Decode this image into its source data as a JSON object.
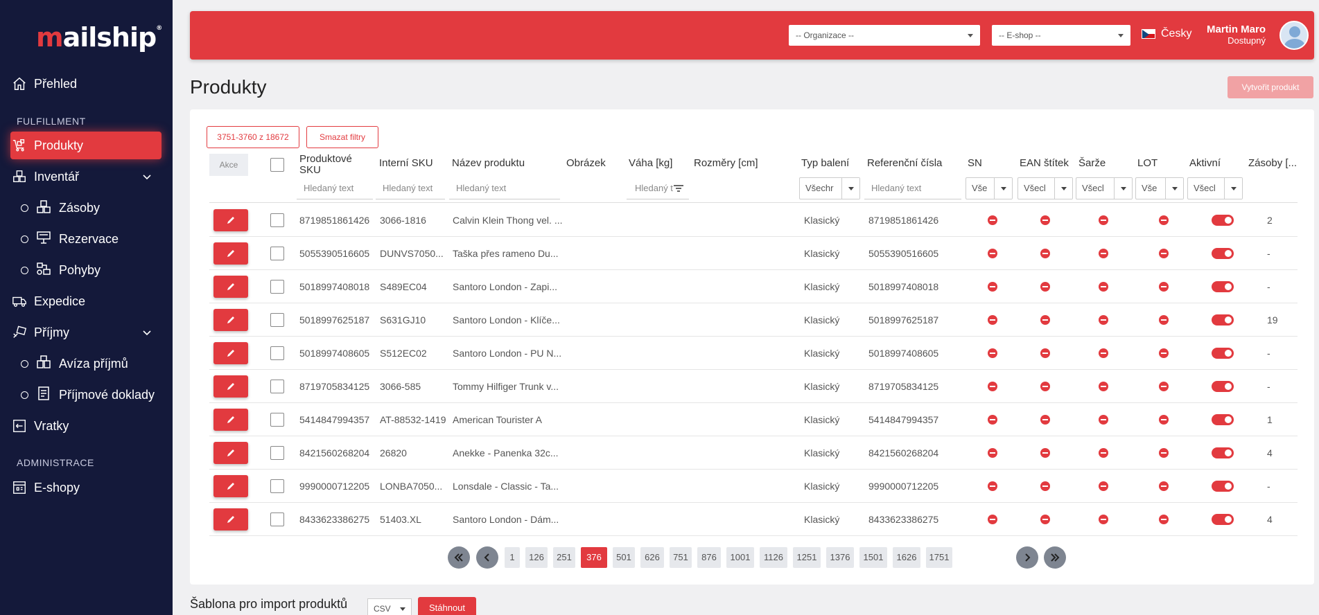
{
  "app": {
    "logo": "mailship",
    "logo_mark": "®"
  },
  "sidebar": {
    "overview": "Přehled",
    "section_fulfillment": "FULFILLMENT",
    "products": "Produkty",
    "inventory": "Inventář",
    "stock": "Zásoby",
    "reservations": "Rezervace",
    "movements": "Pohyby",
    "expedition": "Expedice",
    "receipts": "Příjmy",
    "receipt_notices": "Avíza příjmů",
    "receipt_docs": "Příjmové doklady",
    "returns": "Vratky",
    "section_admin": "ADMINISTRACE",
    "eshops": "E-shopy"
  },
  "header": {
    "org_select": "-- Organizace --",
    "eshop_select": "-- E-shop --",
    "language": "Česky",
    "user_name": "Martin Maro",
    "user_status": "Dostupný"
  },
  "page": {
    "title": "Produkty",
    "create_button": "Vytvořit produkt"
  },
  "toolbar": {
    "range_chip": "3751-3760 z 18672",
    "clear_filters": "Smazat filtry"
  },
  "table": {
    "columns": {
      "akce": "Akce",
      "sku_line1": "Produktové",
      "sku_line2": "SKU",
      "internal_sku": "Interní SKU",
      "name": "Název produktu",
      "image": "Obrázek",
      "weight": "Váha [kg]",
      "dimensions": "Rozměry [cm]",
      "package_type": "Typ balení",
      "ref_numbers": "Referenční čísla",
      "sn": "SN",
      "ean": "EAN štítek",
      "batch": "Šarže",
      "lot": "LOT",
      "active": "Aktivní",
      "stock": "Zásoby [..."
    },
    "filters": {
      "search_placeholder": "Hledaný text",
      "weight_placeholder": "Hledaný t",
      "package_all": "Všechr",
      "sn_all": "Vše",
      "ean_all": "Všecl",
      "batch_all": "Všecl",
      "lot_all": "Vše",
      "active_all": "Všecl"
    },
    "rows": [
      {
        "sku": "8719851861426",
        "internal": "3066-1816",
        "name": "Calvin Klein Thong vel. ...",
        "package": "Klasický",
        "ref": "8719851861426",
        "stock": "2"
      },
      {
        "sku": "5055390516605",
        "internal": "DUNVS7050...",
        "name": "Taška přes rameno Du...",
        "package": "Klasický",
        "ref": "5055390516605",
        "stock": "-"
      },
      {
        "sku": "5018997408018",
        "internal": "S489EC04",
        "name": "Santoro London - Zapi...",
        "package": "Klasický",
        "ref": "5018997408018",
        "stock": "-"
      },
      {
        "sku": "5018997625187",
        "internal": "S631GJ10",
        "name": "Santoro London - Klíče...",
        "package": "Klasický",
        "ref": "5018997625187",
        "stock": "19"
      },
      {
        "sku": "5018997408605",
        "internal": "S512EC02",
        "name": "Santoro London - PU N...",
        "package": "Klasický",
        "ref": "5018997408605",
        "stock": "-"
      },
      {
        "sku": "8719705834125",
        "internal": "3066-585",
        "name": "Tommy Hilfiger Trunk v...",
        "package": "Klasický",
        "ref": "8719705834125",
        "stock": "-"
      },
      {
        "sku": "5414847994357",
        "internal": "AT-88532-1419",
        "name": "American Tourister A",
        "package": "Klasický",
        "ref": "5414847994357",
        "stock": "1"
      },
      {
        "sku": "8421560268204",
        "internal": "26820",
        "name": "Anekke - Panenka 32c...",
        "package": "Klasický",
        "ref": "8421560268204",
        "stock": "4"
      },
      {
        "sku": "9990000712205",
        "internal": "LONBA7050...",
        "name": "Lonsdale - Classic - Ta...",
        "package": "Klasický",
        "ref": "9990000712205",
        "stock": "-"
      },
      {
        "sku": "8433623386275",
        "internal": "51403.XL",
        "name": "Santoro London - Dám...",
        "package": "Klasický",
        "ref": "8433623386275",
        "stock": "4"
      }
    ]
  },
  "pagination": {
    "pages": [
      "1",
      "126",
      "251",
      "376",
      "501",
      "626",
      "751",
      "876",
      "1001",
      "1126",
      "1251",
      "1376",
      "1501",
      "1626",
      "1751"
    ],
    "active": "376"
  },
  "footer": {
    "template_title": "Šablona pro import produktů",
    "format": "CSV",
    "download": "Stáhnout"
  },
  "colors": {
    "accent": "#e23a3f",
    "sidebar": "#14193a"
  }
}
